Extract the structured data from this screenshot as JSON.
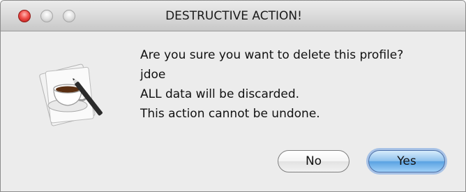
{
  "window": {
    "title": "DESTRUCTIVE ACTION!"
  },
  "titlebar": {
    "buttons": [
      "close",
      "minimize",
      "zoom"
    ]
  },
  "dialog": {
    "icon": "coffee-cup-pen-icon",
    "lines": [
      "Are you sure you want to delete this profile?",
      "jdoe",
      "ALL data will be discarded.",
      "This action cannot be undone."
    ]
  },
  "buttons": {
    "no_label": "No",
    "yes_label": "Yes"
  },
  "colors": {
    "close_button": "#f0504c",
    "default_button": "#5aa2e2",
    "window_background": "#ececec"
  }
}
